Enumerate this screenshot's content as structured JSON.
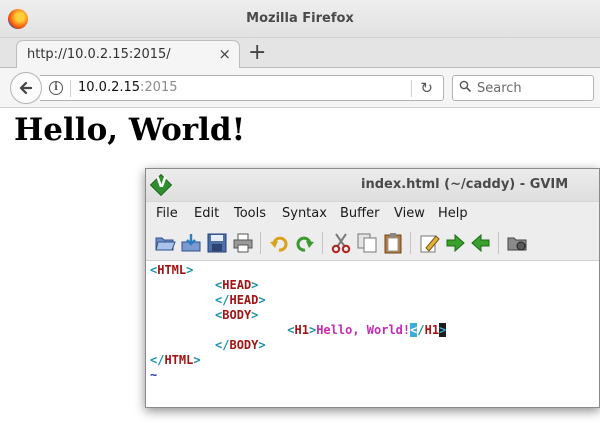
{
  "firefox": {
    "window_title": "Mozilla Firefox",
    "tab": {
      "label": "http://10.0.2.15:2015/",
      "close_glyph": "×"
    },
    "new_tab_glyph": "+",
    "url": {
      "host": "10.0.2.15",
      "port": ":2015"
    },
    "search": {
      "placeholder": "Search"
    },
    "icons": [
      "firefox-logo",
      "back-arrow-icon",
      "info-icon",
      "reload-icon",
      "search-icon"
    ]
  },
  "page": {
    "heading": "Hello, World!"
  },
  "gvim": {
    "title": "index.html (~/caddy) - GVIM",
    "menu": [
      "File",
      "Edit",
      "Tools",
      "Syntax",
      "Buffer",
      "View",
      "Help"
    ],
    "toolbar_icons": [
      "open-file-icon",
      "save-download-icon",
      "save-icon",
      "print-icon",
      "undo-icon",
      "redo-icon",
      "cut-icon",
      "copy-icon",
      "paste-icon",
      "find-replace-icon",
      "forward-arrow-icon",
      "back-arrow-icon",
      "make-icon"
    ],
    "editor": {
      "lines": {
        "l1_open": "<",
        "l1_tag": "HTML",
        "l1_close": ">",
        "l2_open": "<",
        "l2_tag": "HEAD",
        "l2_close": ">",
        "l3_open": "</",
        "l3_tag": "HEAD",
        "l3_close": ">",
        "l4_open": "<",
        "l4_tag": "BODY",
        "l4_close": ">",
        "l5_open": "<",
        "l5_tag": "H1",
        "l5_mid": ">",
        "l5_text": "Hello, World!",
        "l5_cursor_hl": "<",
        "l5_slash": "/",
        "l5_endtag": "H1",
        "l5_cursor_block": ">",
        "l6_open": "</",
        "l6_tag": "BODY",
        "l6_close": ">",
        "l7_open": "</",
        "l7_tag": "HTML",
        "l7_close": ">",
        "l8_tilde": "~"
      }
    }
  }
}
